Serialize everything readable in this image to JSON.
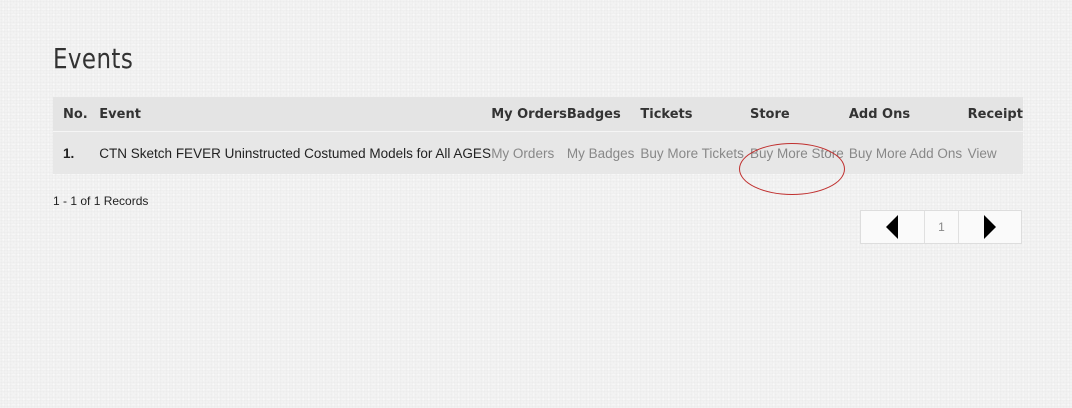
{
  "page": {
    "title": "Events"
  },
  "table": {
    "headers": {
      "no": "No.",
      "event": "Event",
      "my_orders": "My Orders",
      "badges": "Badges",
      "tickets": "Tickets",
      "store": "Store",
      "add_ons": "Add Ons",
      "receipt": "Receipt"
    },
    "rows": [
      {
        "no": "1.",
        "event": "CTN Sketch FEVER Uninstructed Costumed Models for All AGES",
        "my_orders": "My Orders",
        "badges": "My Badges",
        "tickets": "Buy More Tickets",
        "store": "Buy More Store",
        "add_ons": "Buy More Add Ons",
        "receipt": "View"
      }
    ]
  },
  "records": "1 - 1 of 1 Records",
  "pagination": {
    "current_page": "1",
    "prev_icon": "caret-left-icon",
    "next_icon": "caret-right-icon"
  },
  "annotation": {
    "color": "#c0302f",
    "target": "Buy More Store"
  }
}
